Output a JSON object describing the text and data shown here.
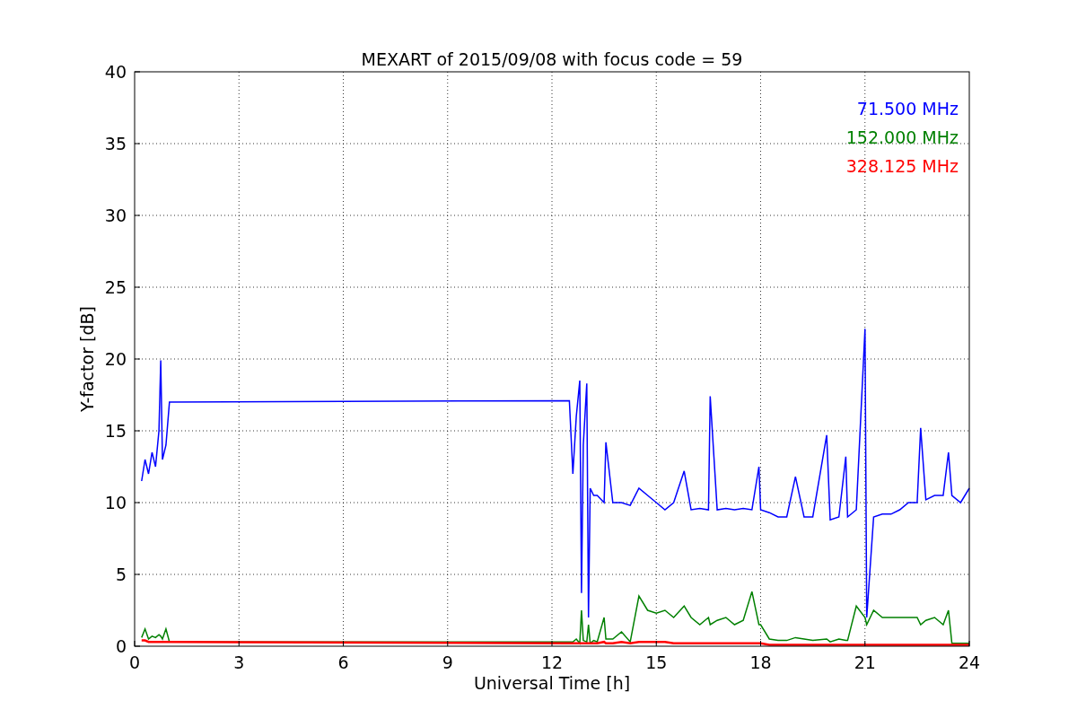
{
  "chart": {
    "chart_data": {
      "type": "line",
      "title": "MEXART of 2015/09/08 with focus code = 59",
      "xlabel": "Universal Time [h]",
      "ylabel": "Y-factor [dB]",
      "xlim": [
        0,
        24
      ],
      "ylim": [
        0,
        40
      ],
      "xticks": [
        0,
        3,
        6,
        9,
        12,
        15,
        18,
        21,
        24
      ],
      "yticks": [
        0,
        5,
        10,
        15,
        20,
        25,
        30,
        35,
        40
      ],
      "grid": true,
      "x": [
        0.2,
        0.3,
        0.4,
        0.5,
        0.6,
        0.7,
        0.75,
        0.8,
        0.9,
        1.0,
        12.5,
        12.6,
        12.7,
        12.8,
        12.85,
        12.9,
        13.0,
        13.05,
        13.1,
        13.2,
        13.3,
        13.5,
        13.55,
        13.75,
        14,
        14.25,
        14.5,
        14.75,
        15,
        15.25,
        15.5,
        15.8,
        16,
        16.25,
        16.5,
        16.55,
        16.75,
        17,
        17.25,
        17.5,
        17.75,
        17.95,
        18,
        18.25,
        18.5,
        18.75,
        19,
        19.25,
        19.5,
        19.9,
        20,
        20.25,
        20.45,
        20.5,
        20.75,
        21,
        21.05,
        21.25,
        21.5,
        21.75,
        22,
        22.25,
        22.5,
        22.6,
        22.75,
        23,
        23.25,
        23.4,
        23.5,
        23.75,
        24
      ],
      "series": [
        {
          "name": "71.500 MHz",
          "color": "#0000ff",
          "values": [
            11.5,
            13,
            12,
            13.5,
            12.5,
            15,
            19.9,
            13,
            14,
            17,
            17.1,
            12,
            16,
            18.5,
            3.7,
            14,
            18.3,
            2,
            11,
            10.5,
            10.5,
            10,
            14.2,
            10,
            10,
            9.8,
            11,
            10.5,
            10,
            9.5,
            10,
            12.2,
            9.5,
            9.6,
            9.5,
            17.4,
            9.5,
            9.6,
            9.5,
            9.6,
            9.5,
            12.5,
            9.5,
            9.3,
            9,
            9,
            11.8,
            9,
            9,
            14.7,
            8.8,
            9,
            13.2,
            9,
            9.5,
            22.1,
            2,
            9,
            9.2,
            9.2,
            9.5,
            10,
            10,
            15.2,
            10.2,
            10.5,
            10.5,
            13.5,
            10.5,
            10,
            11
          ]
        },
        {
          "name": "152.000 MHz",
          "color": "#008000",
          "values": [
            0.6,
            1.2,
            0.5,
            0.7,
            0.6,
            0.8,
            0.7,
            0.5,
            1.2,
            0.3,
            0.3,
            0.3,
            0.5,
            0.2,
            2.5,
            0.4,
            0.3,
            1.5,
            0.2,
            0.4,
            0.3,
            2,
            0.5,
            0.5,
            1,
            0.3,
            3.5,
            2.5,
            2.3,
            2.5,
            2,
            2.8,
            2,
            1.5,
            2,
            1.5,
            1.8,
            2,
            1.5,
            1.8,
            3.8,
            1.5,
            1.5,
            0.5,
            0.4,
            0.4,
            0.6,
            0.5,
            0.4,
            0.5,
            0.3,
            0.5,
            0.4,
            0.4,
            2.8,
            2,
            1.5,
            2.5,
            2,
            2,
            2,
            2,
            2,
            1.5,
            1.8,
            2,
            1.5,
            2.5,
            0.2,
            0.2,
            0.2
          ]
        },
        {
          "name": "328.125 MHz",
          "color": "#ff0000",
          "values": [
            0.4,
            0.4,
            0.3,
            0.3,
            0.3,
            0.3,
            0.3,
            0.3,
            0.3,
            0.3,
            0.2,
            0.2,
            0.2,
            0.2,
            0.2,
            0.2,
            0.2,
            0.2,
            0.2,
            0.2,
            0.2,
            0.3,
            0.2,
            0.2,
            0.3,
            0.2,
            0.3,
            0.3,
            0.3,
            0.3,
            0.2,
            0.2,
            0.2,
            0.2,
            0.2,
            0.2,
            0.2,
            0.2,
            0.2,
            0.2,
            0.2,
            0.2,
            0.2,
            0.1,
            0.1,
            0.1,
            0.1,
            0.1,
            0.1,
            0.1,
            0.1,
            0.1,
            0.1,
            0.1,
            0.1,
            0.1,
            0.1,
            0.1,
            0.1,
            0.1,
            0.1,
            0.1,
            0.1,
            0.1,
            0.1,
            0.1,
            0.1,
            0.1,
            0.1,
            0.1,
            0.1
          ]
        }
      ]
    }
  }
}
